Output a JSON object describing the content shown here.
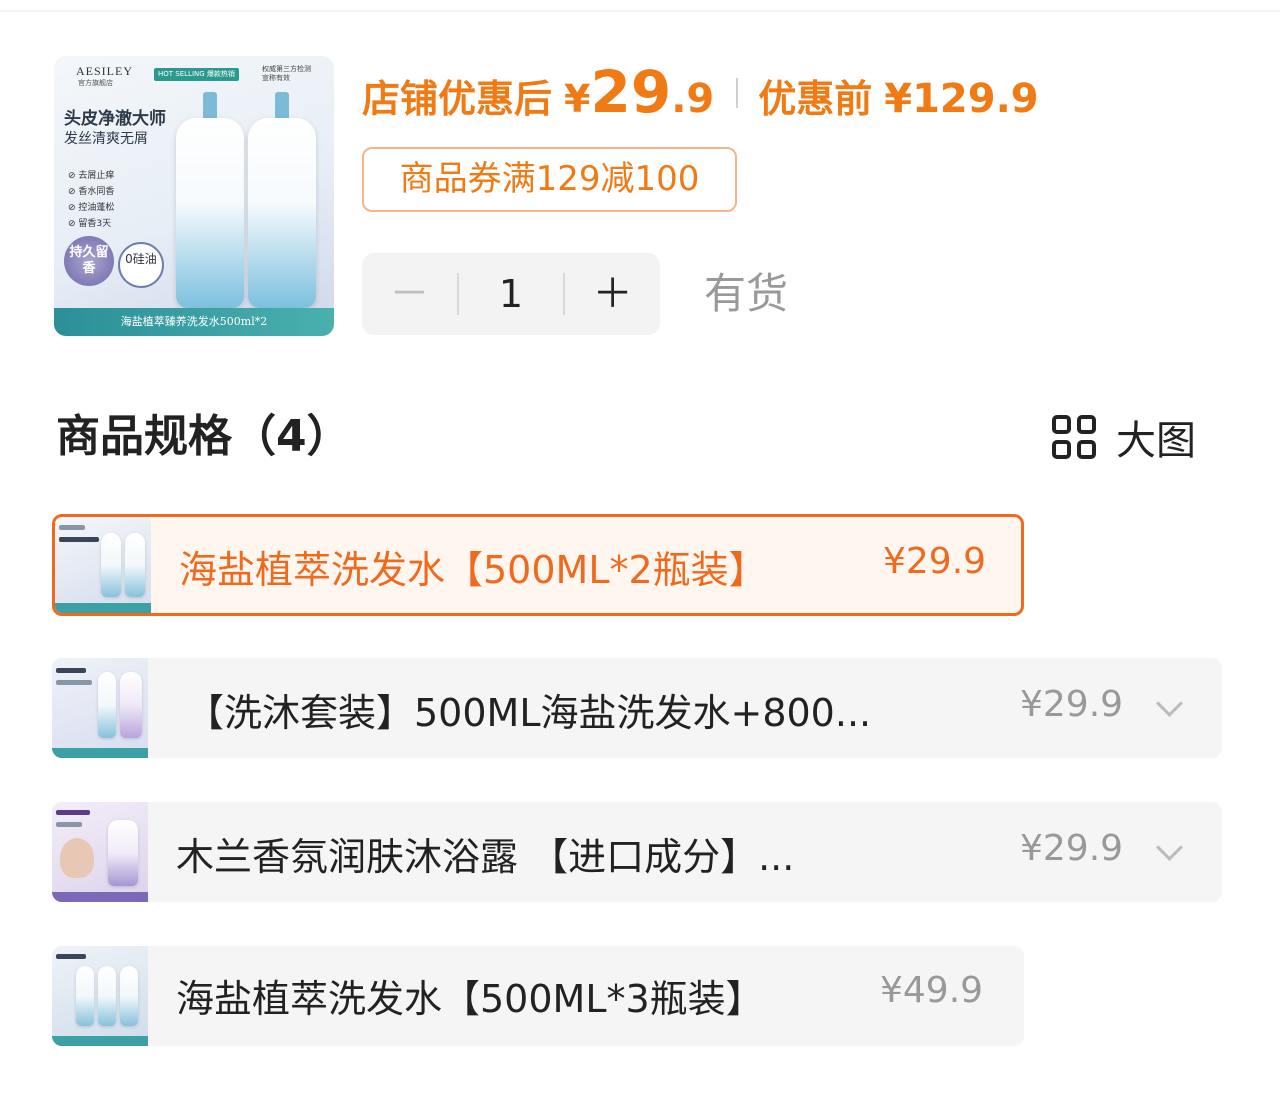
{
  "product": {
    "image": {
      "brand": "AESILEY",
      "brand_sub": "官方旗舰店",
      "badge": "HOT SELLING 爆款热销",
      "auth_line1": "权威第三方检测",
      "auth_line2": "宣称有效",
      "headline": "头皮净澈大师",
      "subheadline": "发丝清爽无屑",
      "features": [
        "去屑止痒",
        "香水同香",
        "控油蓬松",
        "留香3天"
      ],
      "circle1": "持久留香",
      "circle2": "0硅油",
      "bottom_strip": "海盐植萃臻养洗发水500ml*2"
    },
    "price_after_label": "店铺优惠后",
    "currency": "¥",
    "price_after_int": "29",
    "price_after_dec": ".9",
    "price_before_label": "优惠前",
    "price_before": "¥129.9",
    "coupon": "商品券满129减100",
    "quantity": "1",
    "minus_label": "－",
    "plus_label": "＋",
    "stock_status": "有货"
  },
  "specs": {
    "title": "商品规格（4）",
    "big_view_label": "大图",
    "items": [
      {
        "name": "海盐植萃洗发水【500ML*2瓶装】",
        "price": "¥29.9",
        "selected": true
      },
      {
        "name": "【洗沐套装】500ML海盐洗发水+800...",
        "price": "¥29.9",
        "selected": false
      },
      {
        "name": "木兰香氛润肤沐浴露 【进口成分】...",
        "price": "¥29.9",
        "selected": false
      },
      {
        "name": "海盐植萃洗发水【500ML*3瓶装】",
        "price": "¥49.9",
        "selected": false
      }
    ]
  },
  "colors": {
    "accent": "#f07a14",
    "selected_border": "#f06a1e",
    "muted": "#999999"
  }
}
